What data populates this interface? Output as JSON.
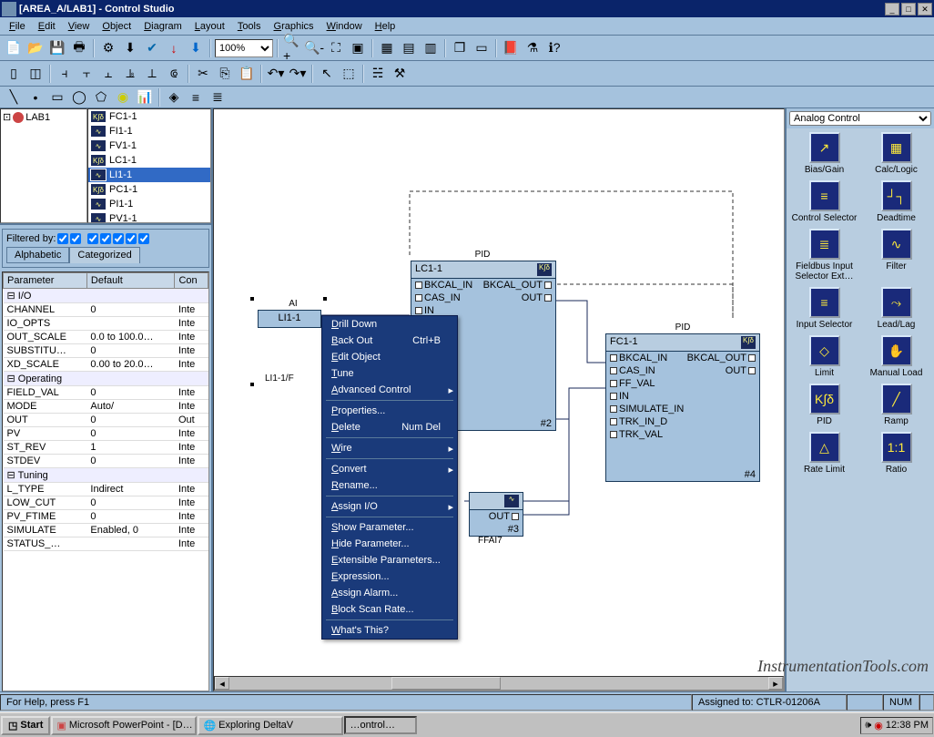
{
  "window": {
    "title": "[AREA_A/LAB1] - Control Studio"
  },
  "menu": [
    "File",
    "Edit",
    "View",
    "Object",
    "Diagram",
    "Layout",
    "Tools",
    "Graphics",
    "Window",
    "Help"
  ],
  "zoom": "100%",
  "tree": {
    "root": "LAB1",
    "items": [
      "FC1-1",
      "FI1-1",
      "FV1-1",
      "LC1-1",
      "LI1-1",
      "PC1-1",
      "PI1-1",
      "PV1-1"
    ],
    "selected": "LI1-1"
  },
  "filter": {
    "label": "Filtered by:"
  },
  "paramTabs": [
    "Alphabetic",
    "Categorized"
  ],
  "paramHeaders": [
    "Parameter",
    "Default",
    "Con"
  ],
  "params": [
    {
      "grp": "I/O"
    },
    {
      "p": "CHANNEL",
      "d": "0",
      "c": "Inte"
    },
    {
      "p": "IO_OPTS",
      "d": "",
      "c": "Inte"
    },
    {
      "p": "OUT_SCALE",
      "d": "0.0 to 100.0…",
      "c": "Inte"
    },
    {
      "p": "SUBSTITU…",
      "d": "0",
      "c": "Inte"
    },
    {
      "p": "XD_SCALE",
      "d": "0.00 to 20.0…",
      "c": "Inte"
    },
    {
      "grp": "Operating"
    },
    {
      "p": "FIELD_VAL",
      "d": "0",
      "c": "Inte"
    },
    {
      "p": "MODE",
      "d": "Auto/",
      "c": "Inte"
    },
    {
      "p": "OUT",
      "d": "0",
      "c": "Out"
    },
    {
      "p": "PV",
      "d": "0",
      "c": "Inte"
    },
    {
      "p": "ST_REV",
      "d": "1",
      "c": "Inte"
    },
    {
      "p": "STDEV",
      "d": "0",
      "c": "Inte"
    },
    {
      "grp": "Tuning"
    },
    {
      "p": "L_TYPE",
      "d": "Indirect",
      "c": "Inte"
    },
    {
      "p": "LOW_CUT",
      "d": "0",
      "c": "Inte"
    },
    {
      "p": "PV_FTIME",
      "d": "0",
      "c": "Inte"
    },
    {
      "p": "SIMULATE",
      "d": "Enabled, 0",
      "c": "Inte"
    },
    {
      "p": "STATUS_…",
      "d": "",
      "c": "Inte"
    }
  ],
  "blocks": {
    "ai": {
      "type": "AI",
      "name": "LI1-1",
      "out": "LI1-1/F"
    },
    "pid1": {
      "type": "PID",
      "name": "LC1-1",
      "num": "#2",
      "ports": [
        "BKCAL_IN",
        "BKCAL_OUT",
        "CAS_IN",
        "OUT"
      ]
    },
    "pid2": {
      "type": "PID",
      "name": "FC1-1",
      "num": "#4",
      "ports": [
        "BKCAL_IN",
        "BKCAL_OUT",
        "CAS_IN",
        "OUT",
        "FF_VAL",
        "IN",
        "SIMULATE_IN",
        "TRK_IN_D",
        "TRK_VAL"
      ]
    },
    "ao": {
      "name": "",
      "num": "#3",
      "out": "OUT",
      "ref": "FFAI7"
    }
  },
  "context": [
    {
      "t": "Drill Down"
    },
    {
      "t": "Back Out",
      "s": "Ctrl+B"
    },
    {
      "t": "Edit Object"
    },
    {
      "t": "Tune"
    },
    {
      "t": "Advanced Control",
      "sub": true
    },
    {
      "sep": true
    },
    {
      "t": "Properties..."
    },
    {
      "t": "Delete",
      "s": "Num Del"
    },
    {
      "sep": true
    },
    {
      "t": "Wire",
      "sub": true
    },
    {
      "sep": true
    },
    {
      "t": "Convert",
      "sub": true
    },
    {
      "t": "Rename..."
    },
    {
      "sep": true
    },
    {
      "t": "Assign I/O",
      "sub": true
    },
    {
      "sep": true
    },
    {
      "t": "Show Parameter..."
    },
    {
      "t": "Hide Parameter..."
    },
    {
      "t": "Extensible Parameters..."
    },
    {
      "t": "Expression..."
    },
    {
      "t": "Assign Alarm..."
    },
    {
      "t": "Block Scan Rate..."
    },
    {
      "sep": true
    },
    {
      "t": "What's This?"
    }
  ],
  "paletteCat": "Analog Control",
  "palette": [
    {
      "l": "Bias/Gain",
      "g": "↗"
    },
    {
      "l": "Calc/Logic",
      "g": "▦"
    },
    {
      "l": "Control Selector",
      "g": "≡"
    },
    {
      "l": "Deadtime",
      "g": "┘┐"
    },
    {
      "l": "Fieldbus Input Selector Ext…",
      "g": "≣"
    },
    {
      "l": "Filter",
      "g": "∿"
    },
    {
      "l": "Input Selector",
      "g": "≡"
    },
    {
      "l": "Lead/Lag",
      "g": "⤳"
    },
    {
      "l": "Limit",
      "g": "◇"
    },
    {
      "l": "Manual Load",
      "g": "✋"
    },
    {
      "l": "PID",
      "g": "K∫δ"
    },
    {
      "l": "Ramp",
      "g": "╱"
    },
    {
      "l": "Rate Limit",
      "g": "△"
    },
    {
      "l": "Ratio",
      "g": "1:1"
    }
  ],
  "status": {
    "help": "For Help, press F1",
    "assigned": "Assigned to: CTLR-01206A",
    "num": "NUM"
  },
  "taskbar": {
    "start": "Start",
    "tasks": [
      "Microsoft PowerPoint - [D…",
      "Exploring DeltaV",
      "…ontrol…"
    ],
    "time": "12:38 PM"
  },
  "watermark": "InstrumentationTools.com"
}
